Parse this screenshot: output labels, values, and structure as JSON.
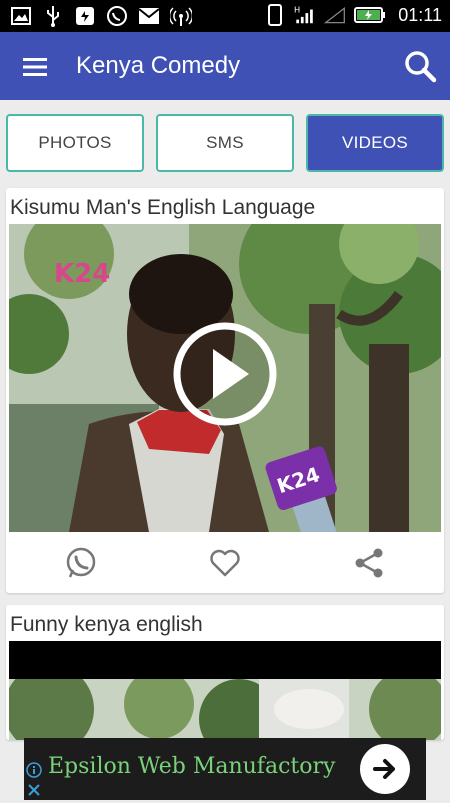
{
  "status_bar": {
    "time": "01:11",
    "left_icons": [
      "image-icon",
      "usb-icon",
      "chat-app-icon",
      "whatsapp-icon",
      "gmail-icon",
      "hotspot-icon"
    ],
    "right_icons": [
      "phone-icon",
      "signal-h-icon",
      "signal-icon",
      "battery-charging-icon"
    ]
  },
  "app_bar": {
    "title": "Kenya Comedy",
    "menu_icon": "menu-icon",
    "search_icon": "search-icon",
    "color": "#3f51b5"
  },
  "tabs": [
    {
      "label": "PHOTOS",
      "active": false
    },
    {
      "label": "SMS",
      "active": false
    },
    {
      "label": "VIDEOS",
      "active": true
    }
  ],
  "colors": {
    "accent": "#3f51b5",
    "tab_border": "#49b8a8",
    "ad_text": "#7ad17a"
  },
  "videos": [
    {
      "title": "Kisumu Man's English Language",
      "thumbnail": "man-interview-thumbnail",
      "watermark": "K24",
      "actions": [
        "whatsapp-share-icon",
        "heart-icon",
        "share-icon"
      ]
    },
    {
      "title": "Funny kenya english",
      "thumbnail": "trees-outdoor-thumbnail"
    }
  ],
  "ad": {
    "text": "Epsilon Web Manufactory",
    "go_icon": "arrow-right-icon",
    "info_icon": "info-icon",
    "close_icon": "close-icon"
  }
}
